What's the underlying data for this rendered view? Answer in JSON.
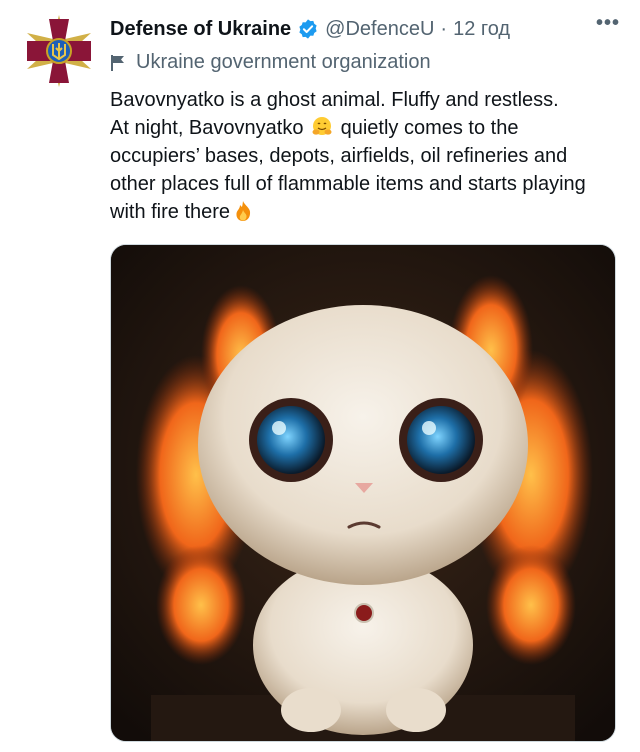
{
  "tweet": {
    "author_name": "Defense of Ukraine",
    "handle": "@DefenceU",
    "separator": "·",
    "time": "12 год",
    "more_label": "•••",
    "account_label": "Ukraine government organization",
    "text_line1": "Bavovnyatko is a ghost animal. Fluffy and restless.",
    "text_line2a": "At night, Bavovnyatko",
    "text_line2b": "quietly comes to the",
    "text_line3": "occupiers’ bases, depots, airfields, oil refineries and",
    "text_line4": "other places full of flammable items and starts playing",
    "text_line5": "with fire there",
    "colors": {
      "name": "#0f1419",
      "secondary": "#536471",
      "verified": "#1d9bf0",
      "border": "#cfd9de",
      "emblem": "#8a1538",
      "emblem_gold": "#c9a227"
    },
    "icons": {
      "verified": "verified-badge-icon",
      "label": "flag-icon",
      "emoji_hug": "hugging-face-emoji",
      "emoji_fire": "fire-emoji"
    }
  }
}
